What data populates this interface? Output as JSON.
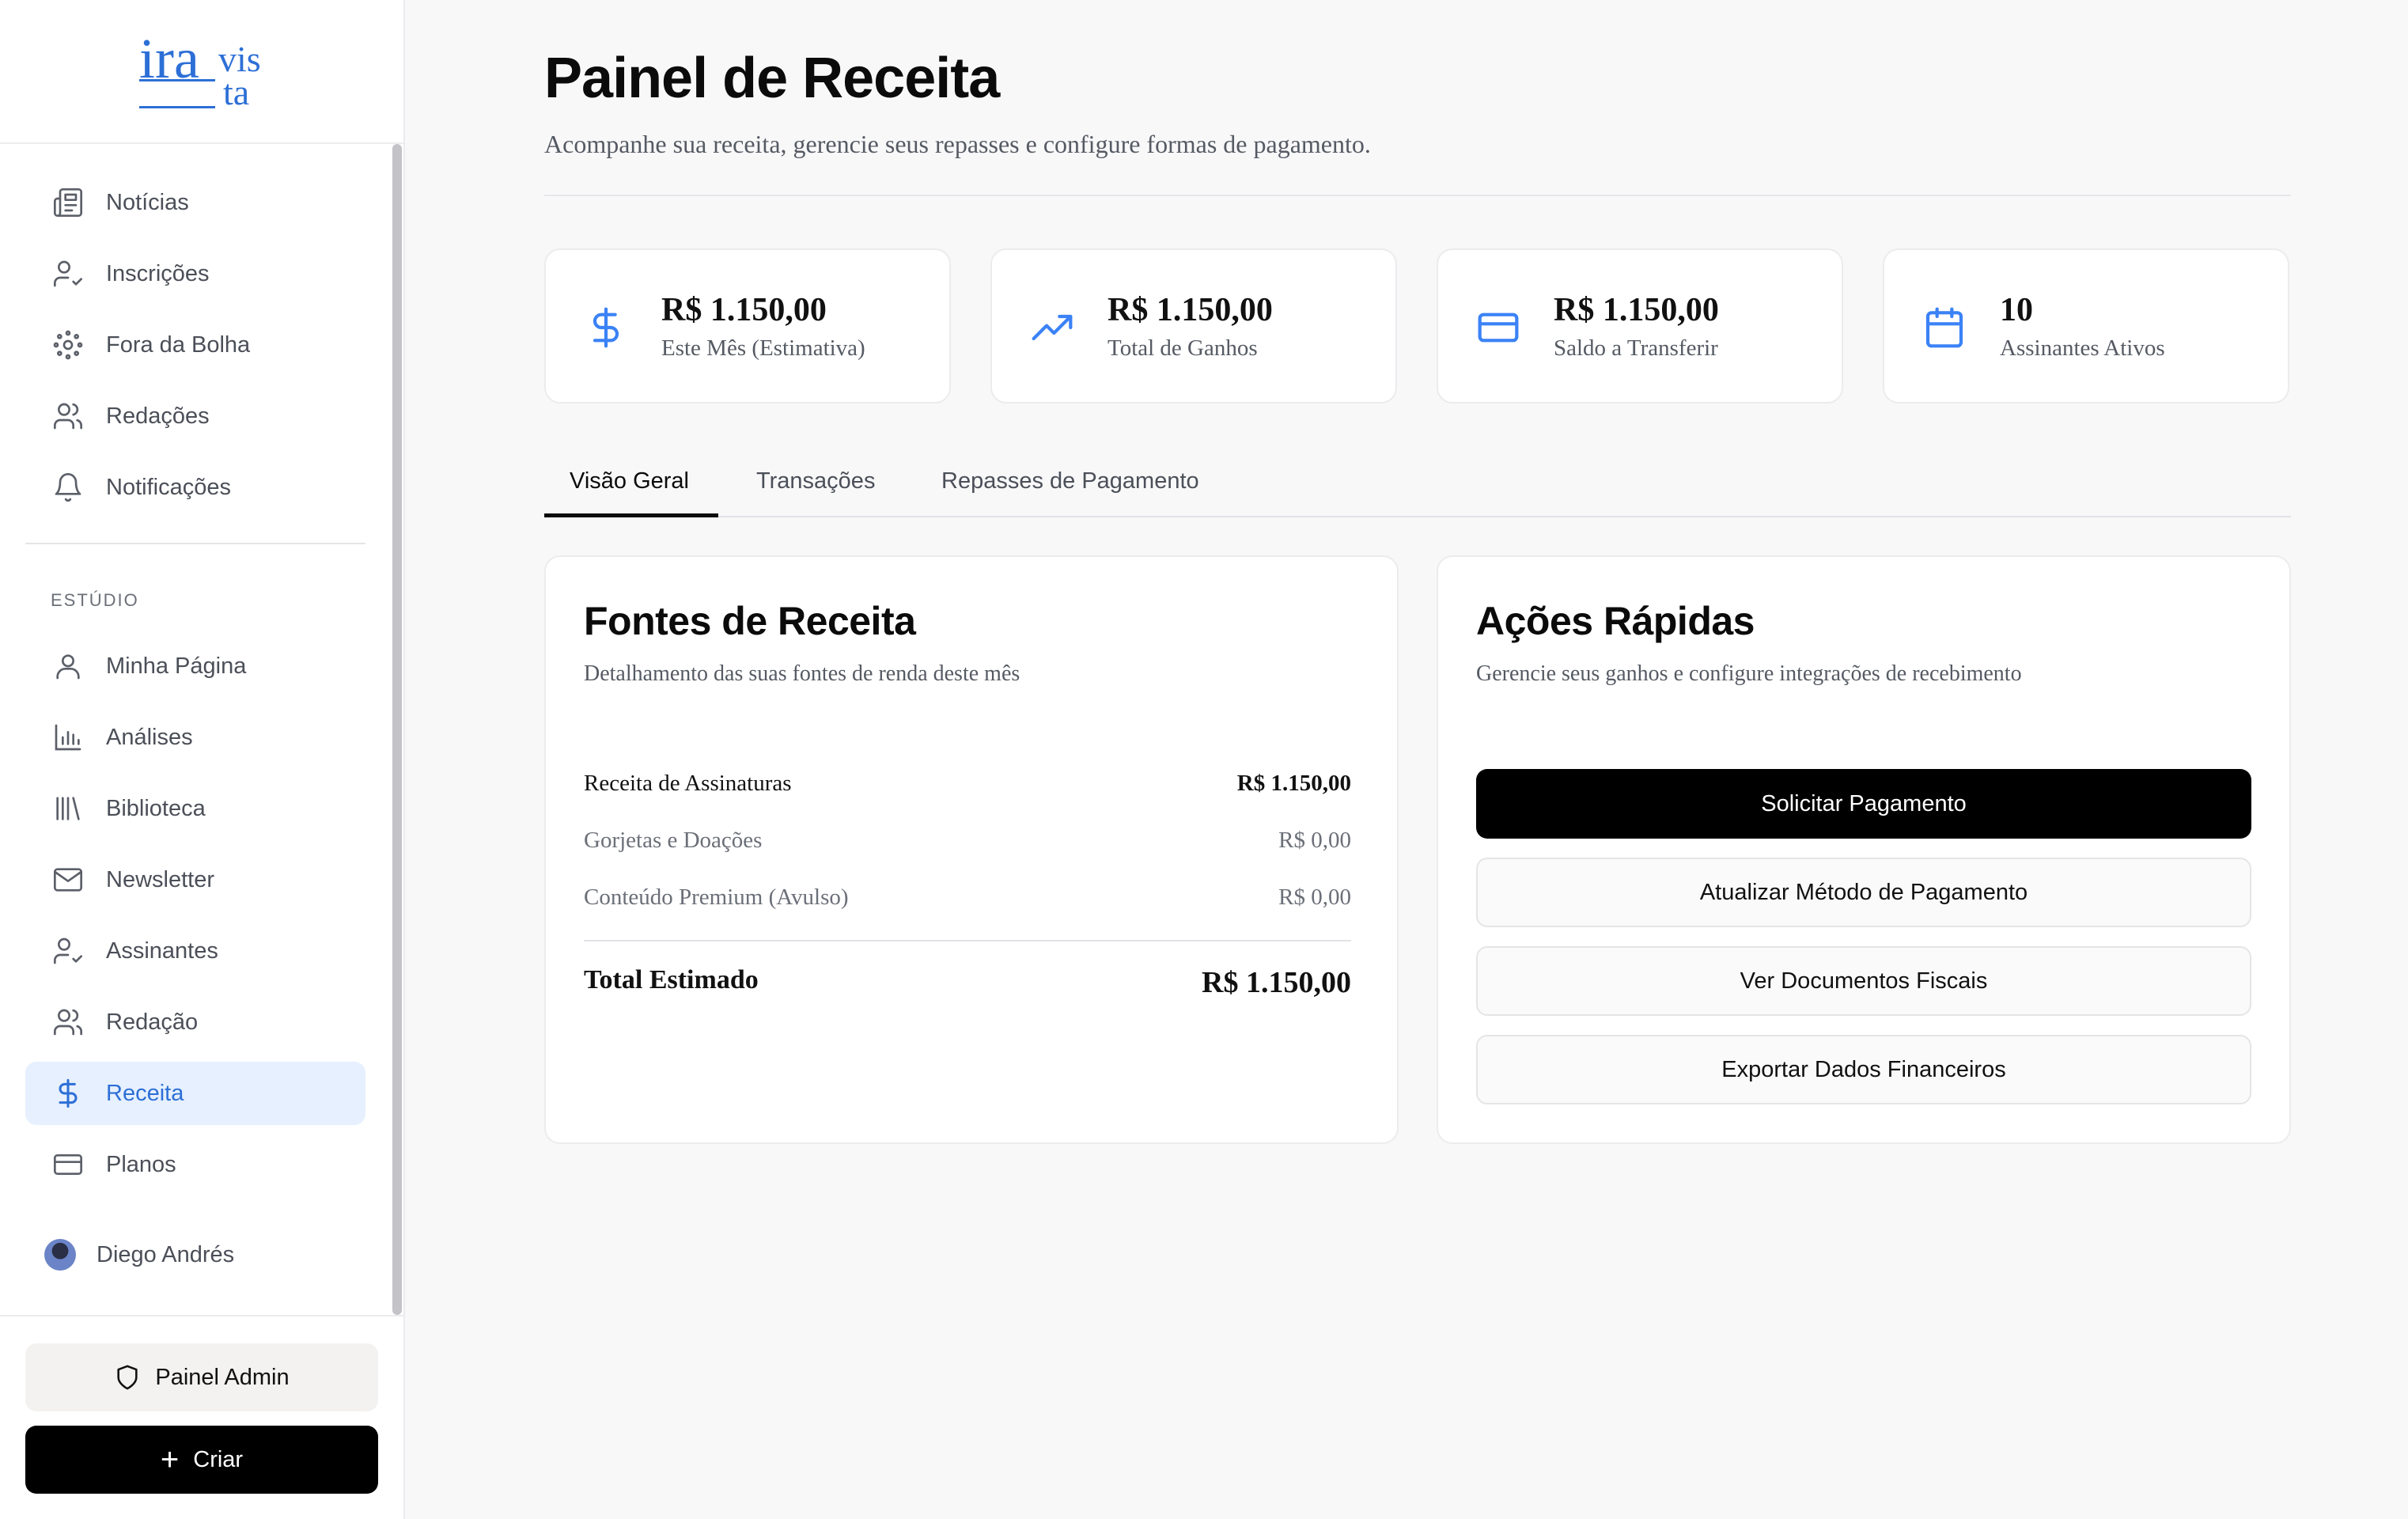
{
  "brand": {
    "logo_line1": "ira",
    "logo_line2": "vis",
    "logo_line3": "ta"
  },
  "sidebar": {
    "primary_items": [
      {
        "label": "Notícias",
        "icon": "newspaper-icon"
      },
      {
        "label": "Inscrições",
        "icon": "user-check-icon"
      },
      {
        "label": "Fora da Bolha",
        "icon": "orbit-icon"
      },
      {
        "label": "Redações",
        "icon": "users-icon"
      },
      {
        "label": "Notificações",
        "icon": "bell-icon"
      }
    ],
    "section_label": "ESTÚDIO",
    "studio_items": [
      {
        "label": "Minha Página",
        "icon": "user-icon"
      },
      {
        "label": "Análises",
        "icon": "bar-chart-icon"
      },
      {
        "label": "Biblioteca",
        "icon": "library-icon"
      },
      {
        "label": "Newsletter",
        "icon": "mail-icon"
      },
      {
        "label": "Assinantes",
        "icon": "user-check-icon"
      },
      {
        "label": "Redação",
        "icon": "users-icon"
      },
      {
        "label": "Receita",
        "icon": "dollar-icon",
        "active": true
      },
      {
        "label": "Planos",
        "icon": "credit-card-icon"
      }
    ],
    "user_name": "Diego Andrés",
    "admin_label": "Painel Admin",
    "create_label": "Criar"
  },
  "header": {
    "title": "Painel de Receita",
    "subtitle": "Acompanhe sua receita, gerencie seus repasses e configure formas de pagamento."
  },
  "stats": [
    {
      "value": "R$ 1.150,00",
      "label": "Este Mês (Estimativa)",
      "icon": "dollar-icon"
    },
    {
      "value": "R$ 1.150,00",
      "label": "Total de Ganhos",
      "icon": "trending-up-icon"
    },
    {
      "value": "R$ 1.150,00",
      "label": "Saldo a Transferir",
      "icon": "credit-card-icon"
    },
    {
      "value": "10",
      "label": "Assinantes Ativos",
      "icon": "calendar-icon"
    }
  ],
  "tabs": [
    {
      "label": "Visão Geral",
      "active": true
    },
    {
      "label": "Transações"
    },
    {
      "label": "Repasses de Pagamento"
    }
  ],
  "revenue": {
    "title": "Fontes de Receita",
    "subtitle": "Detalhamento das suas fontes de renda deste mês",
    "rows": [
      {
        "label": "Receita de Assinaturas",
        "amount": "R$ 1.150,00"
      },
      {
        "label": "Gorjetas e Doações",
        "amount": "R$ 0,00"
      },
      {
        "label": "Conteúdo Premium (Avulso)",
        "amount": "R$ 0,00"
      }
    ],
    "total_label": "Total Estimado",
    "total_amount": "R$ 1.150,00"
  },
  "quick_actions": {
    "title": "Ações Rápidas",
    "subtitle": "Gerencie seus ganhos e configure integrações de recebimento",
    "buttons": [
      {
        "label": "Solicitar Pagamento",
        "style": "primary"
      },
      {
        "label": "Atualizar Método de Pagamento",
        "style": "secondary"
      },
      {
        "label": "Ver Documentos Fiscais",
        "style": "secondary"
      },
      {
        "label": "Exportar Dados Financeiros",
        "style": "secondary"
      }
    ]
  },
  "colors": {
    "accent": "#3b82f6",
    "active_bg": "#e6f0fe",
    "primary_button": "#000000"
  }
}
